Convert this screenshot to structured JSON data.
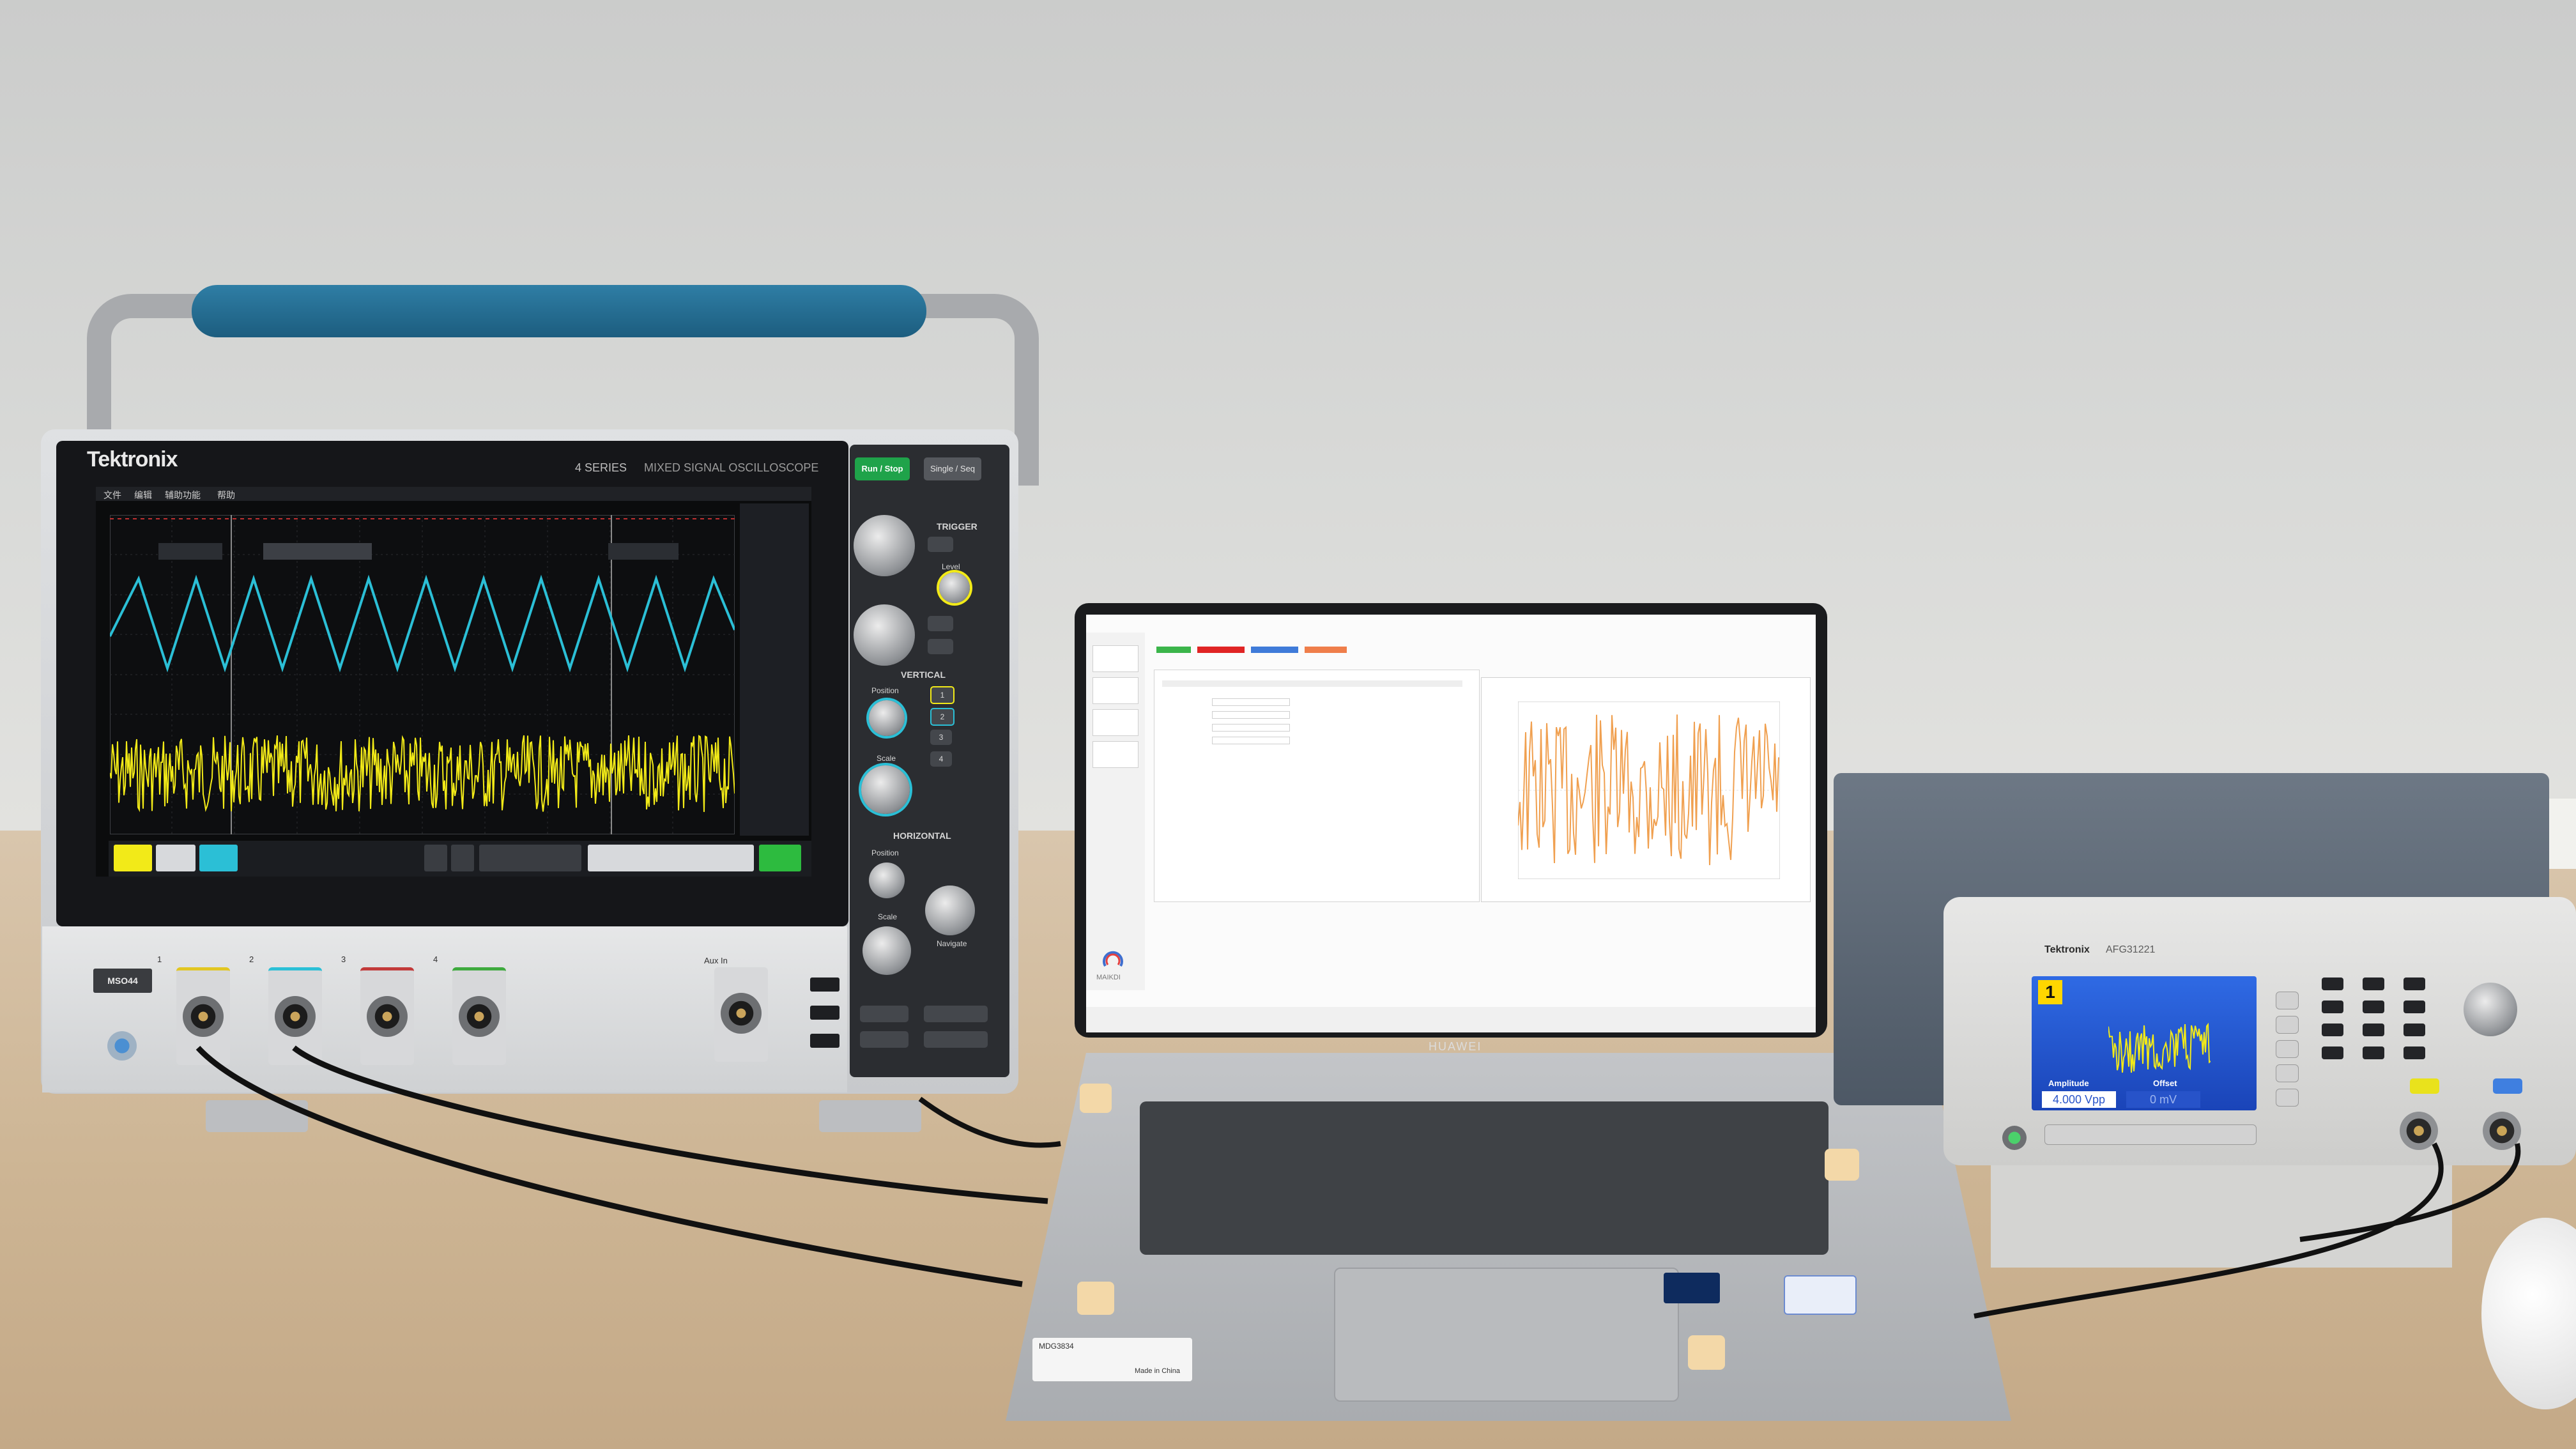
{
  "scope": {
    "brand": "Tektronix",
    "series": "4 SERIES",
    "series_sub": "MIXED SIGNAL OSCILLOSCOPE",
    "model": "MSO44",
    "menu": [
      "文件",
      "编辑",
      "辅助功能",
      "帮助"
    ],
    "buttons": {
      "run_stop": "Run / Stop",
      "single_seq": "Single / Seq"
    },
    "sections": {
      "trigger": "TRIGGER",
      "vertical": "VERTICAL",
      "horizontal": "HORIZONTAL"
    },
    "labels": {
      "level": "Level",
      "position": "Position",
      "scale": "Scale",
      "navigate": "Navigate",
      "aux_in": "Aux In"
    },
    "channels": [
      "1",
      "2",
      "3",
      "4"
    ],
    "waveform_colors": {
      "ch1": "#f2ea18",
      "ch2": "#2bbfd6"
    }
  },
  "laptop": {
    "brand": "HUAWEI",
    "app_logo": "MAIKDI",
    "cert_lines": [
      "MDG3834",
      "Made in China"
    ]
  },
  "generator": {
    "brand": "Tektronix",
    "model": "AFG31221",
    "channel": "1",
    "amplitude_label": "Amplitude",
    "offset_label": "Offset",
    "amplitude_value": "4.000 Vpp",
    "offset_value": "0 mV"
  }
}
